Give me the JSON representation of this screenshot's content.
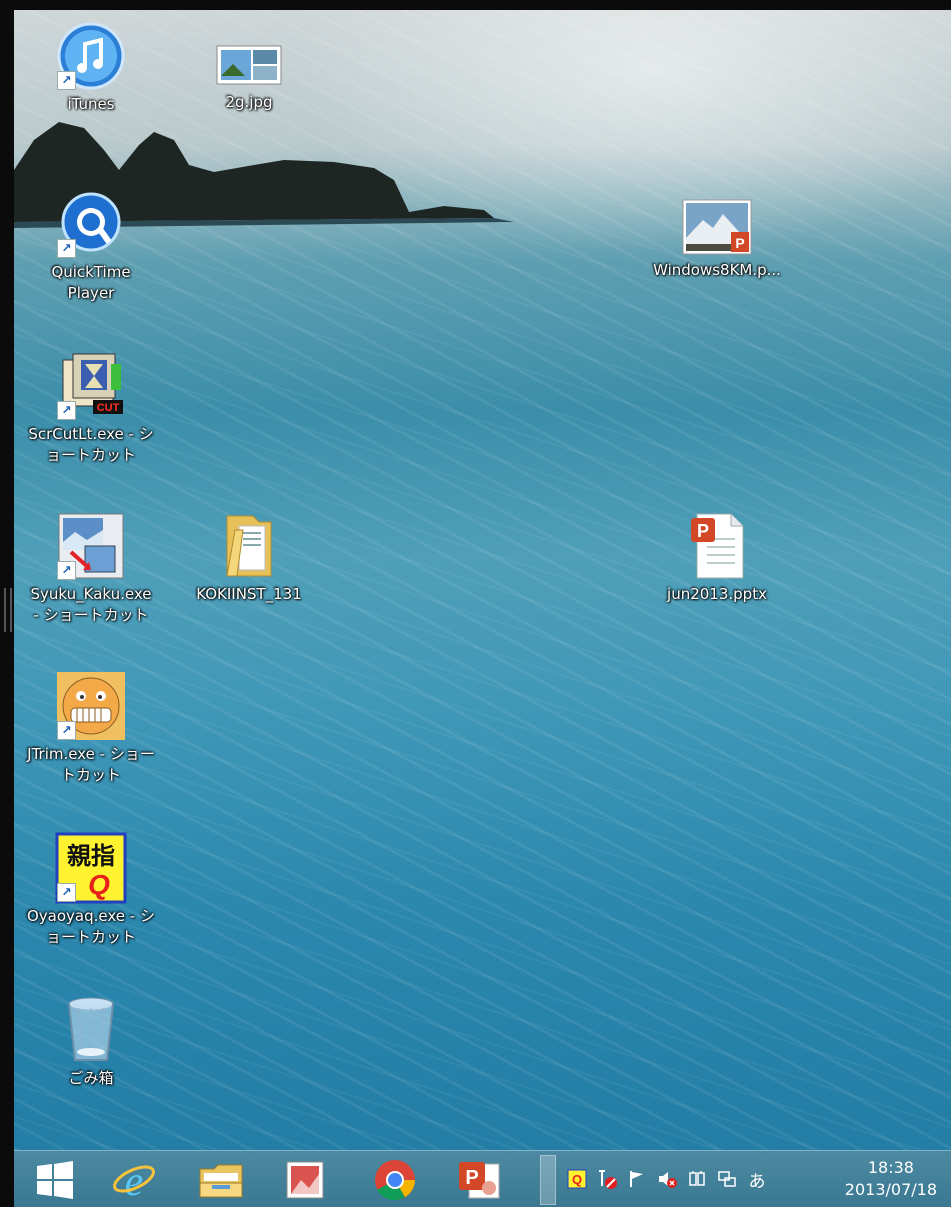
{
  "desktop": {
    "icons": [
      {
        "label": "iTunes",
        "icon": "itunes-icon"
      },
      {
        "label": "2g.jpg",
        "icon": "image-file-icon"
      },
      {
        "label": "QuickTime\nPlayer",
        "icon": "quicktime-icon"
      },
      {
        "label": "Windows8KM.p...",
        "icon": "powerpoint-picture-icon"
      },
      {
        "label": "ScrCutLt.exe - シ\nョートカット",
        "icon": "scrcut-icon"
      },
      {
        "label": "Syuku_Kaku.exe\n- ショートカット",
        "icon": "syukukaku-icon"
      },
      {
        "label": "KOKIINST_131",
        "icon": "folder-icon"
      },
      {
        "label": "jun2013.pptx",
        "icon": "pptx-file-icon"
      },
      {
        "label": "JTrim.exe - ショー\nトカット",
        "icon": "jtrim-icon"
      },
      {
        "label": "Oyaoyaq.exe - シ\nョートカット",
        "icon": "oyaoyaq-icon"
      },
      {
        "label": "ごみ箱",
        "icon": "recycle-bin-icon"
      }
    ]
  },
  "taskbar": {
    "pinned": [
      {
        "name": "start",
        "icon": "windows-logo-icon"
      },
      {
        "name": "internet-explorer",
        "icon": "ie-icon"
      },
      {
        "name": "file-explorer",
        "icon": "file-explorer-icon"
      },
      {
        "name": "picture-app",
        "icon": "picture-app-icon"
      },
      {
        "name": "chrome",
        "icon": "chrome-icon"
      },
      {
        "name": "powerpoint",
        "icon": "powerpoint-icon"
      }
    ],
    "tray": {
      "ime": "あ"
    },
    "clock": {
      "time": "18:38",
      "date": "2013/07/18"
    }
  },
  "colors": {
    "taskbar": "#3f7f97",
    "desktop_accent": "#3b8eaa"
  }
}
